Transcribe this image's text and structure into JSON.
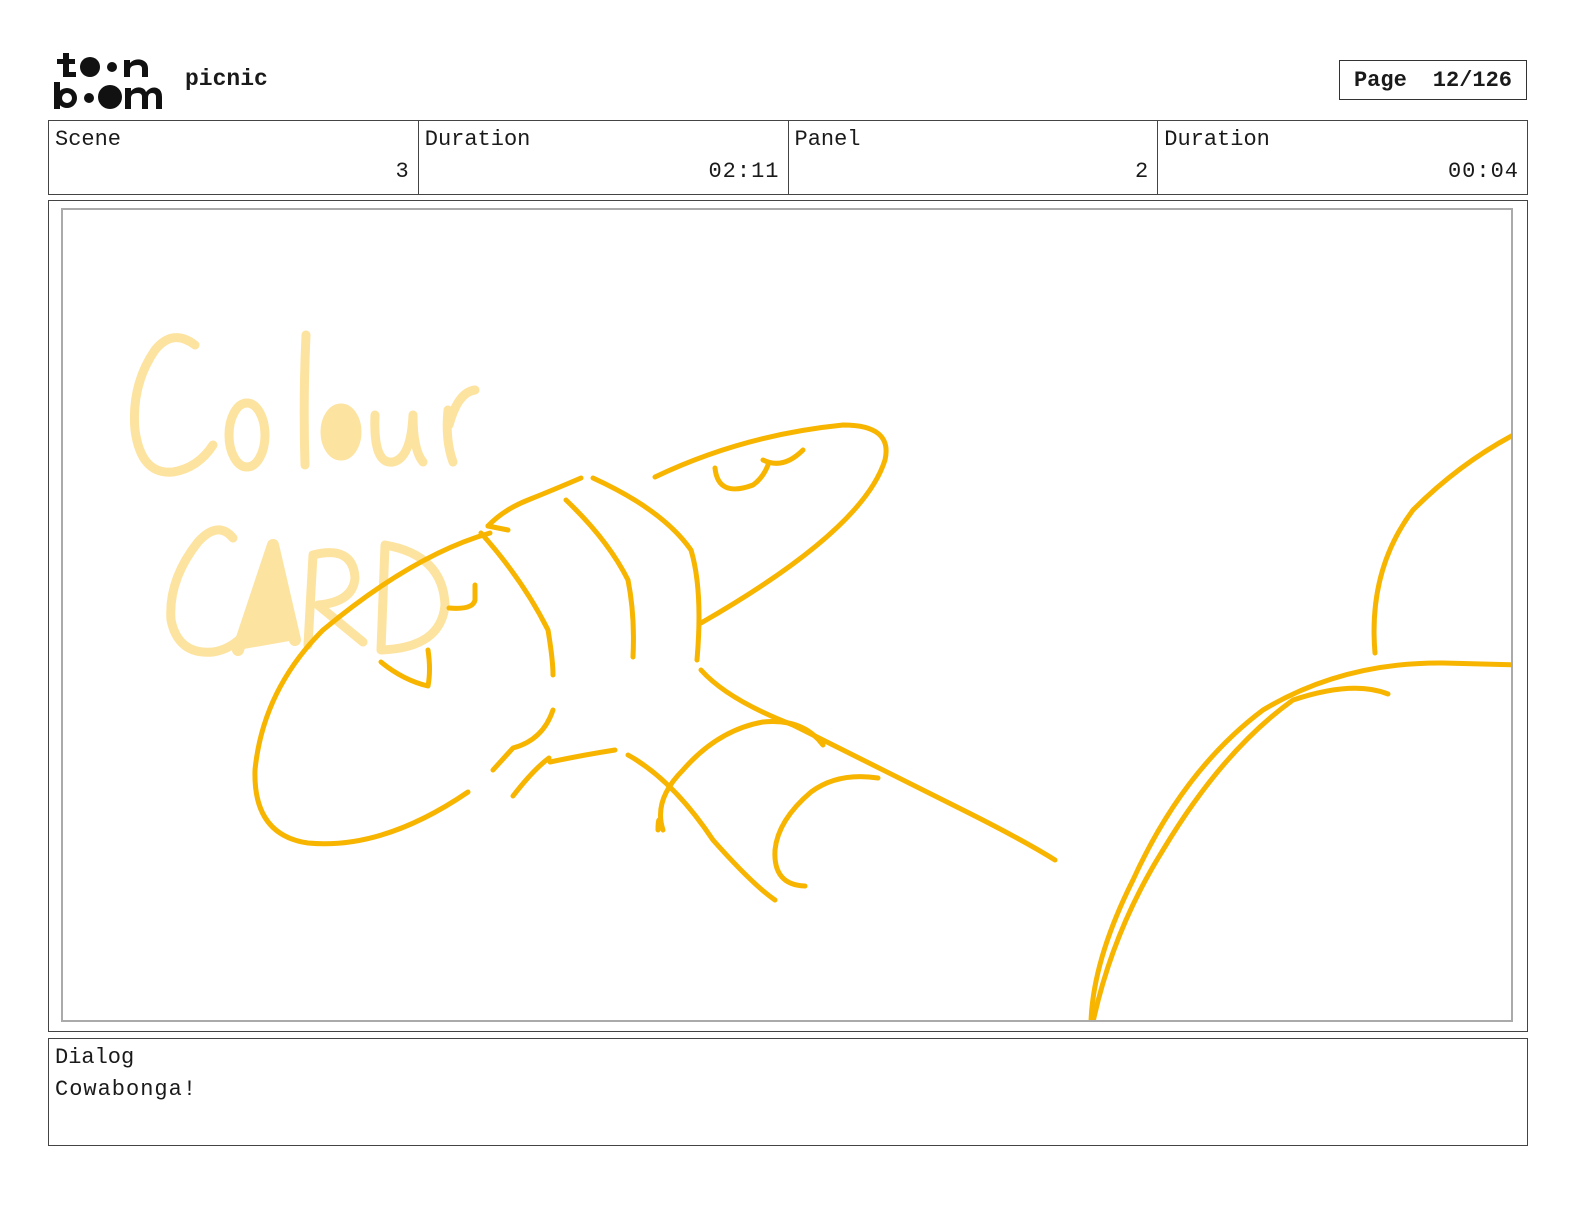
{
  "header": {
    "logo_text": "toon boom",
    "project_name": "picnic",
    "page_label": "Page",
    "page_value": "12/126"
  },
  "info": {
    "scene_label": "Scene",
    "scene_value": "3",
    "scene_duration_label": "Duration",
    "scene_duration_value": "02:11",
    "panel_label": "Panel",
    "panel_value": "2",
    "panel_duration_label": "Duration",
    "panel_duration_value": "00:04"
  },
  "drawing": {
    "overlay_text_line1": "Colour",
    "overlay_text_line2": "CARD",
    "stroke_color": "#f7b500",
    "overlay_color": "#fde3a0"
  },
  "dialog": {
    "label": "Dialog",
    "text": "Cowabonga!"
  }
}
